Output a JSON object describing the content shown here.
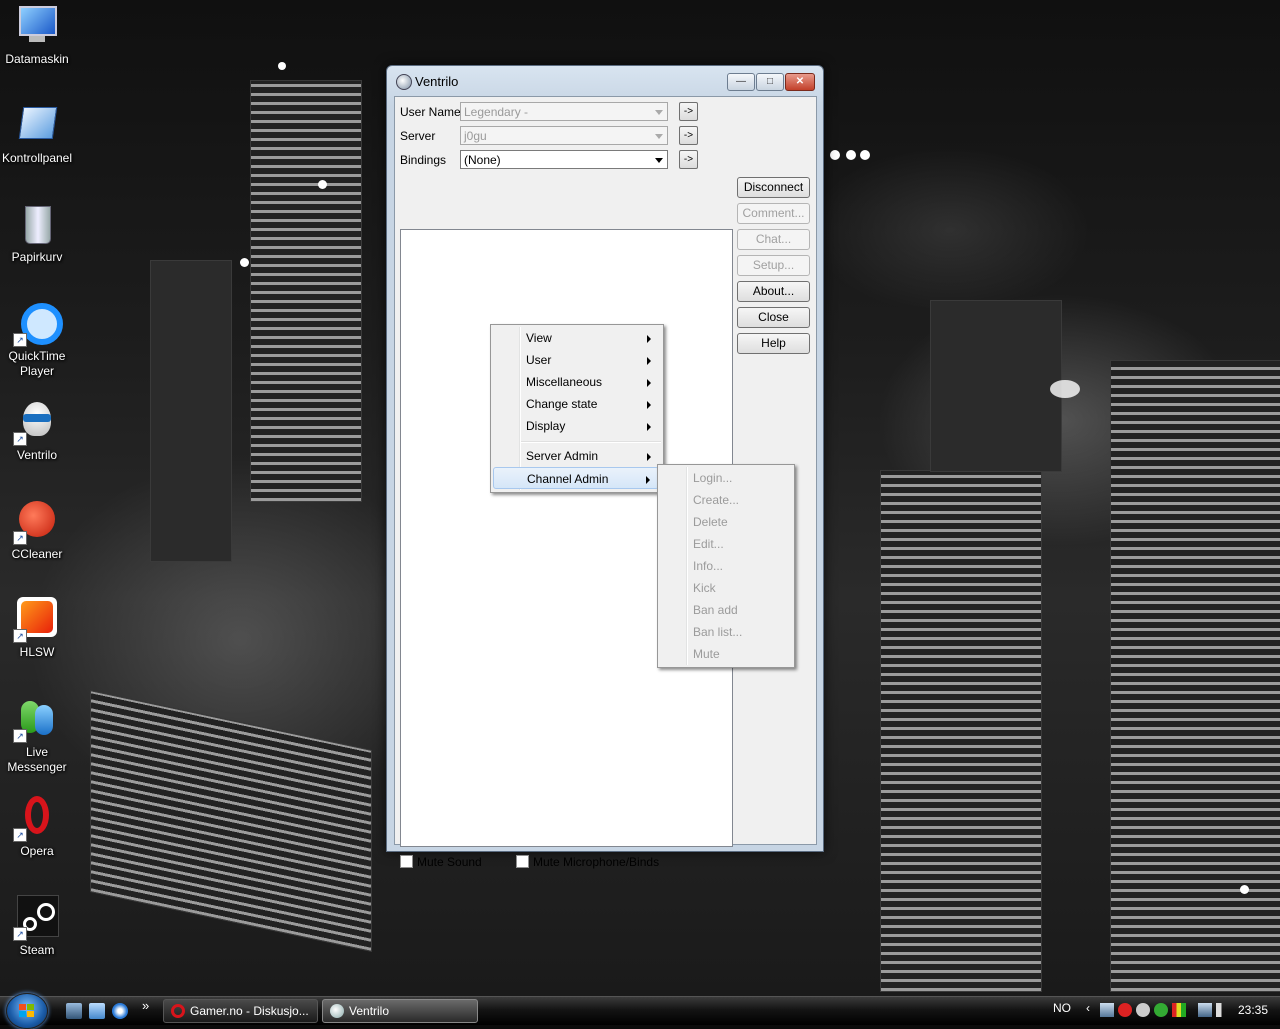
{
  "desktop": {
    "icons": [
      {
        "label": "Datamaskin",
        "icon": "computer-icon"
      },
      {
        "label": "Kontrollpanel",
        "icon": "control-panel-icon"
      },
      {
        "label": "Papirkurv",
        "icon": "recycle-bin-icon"
      },
      {
        "label": "QuickTime Player",
        "icon": "quicktime-icon"
      },
      {
        "label": "Ventrilo",
        "icon": "ventrilo-icon"
      },
      {
        "label": "CCleaner",
        "icon": "ccleaner-icon"
      },
      {
        "label": "HLSW",
        "icon": "hlsw-icon"
      },
      {
        "label": "Live Messenger",
        "icon": "messenger-icon"
      },
      {
        "label": "Opera",
        "icon": "opera-icon"
      },
      {
        "label": "Steam",
        "icon": "steam-icon"
      }
    ]
  },
  "window": {
    "title": "Ventrilo",
    "caption_buttons": {
      "minimize": "—",
      "maximize": "□",
      "close": "✕"
    },
    "fields": {
      "username_label": "User Name",
      "username_value": "Legendary -",
      "server_label": "Server",
      "server_value": "j0gu",
      "bindings_label": "Bindings",
      "bindings_value": "(None)",
      "arrow_button": "->"
    },
    "buttons": {
      "disconnect": "Disconnect",
      "comment": "Comment...",
      "chat": "Chat...",
      "setup": "Setup...",
      "about": "About...",
      "close": "Close",
      "help": "Help"
    },
    "checkboxes": {
      "mute_sound": "Mute Sound",
      "mute_mic": "Mute Microphone/Binds"
    }
  },
  "context_menu": {
    "items": [
      "View",
      "User",
      "Miscellaneous",
      "Change state",
      "Display"
    ],
    "admin_items": [
      "Server Admin",
      "Channel Admin"
    ]
  },
  "submenu": {
    "items": [
      "Login...",
      "Create...",
      "Delete",
      "Edit...",
      "Info...",
      "Kick",
      "Ban add",
      "Ban list...",
      "Mute"
    ]
  },
  "taskbar": {
    "overflow": "»",
    "tasks": [
      {
        "label": "Gamer.no - Diskusjo...",
        "icon": "opera-icon"
      },
      {
        "label": "Ventrilo",
        "icon": "ventrilo-icon"
      }
    ],
    "language": "NO",
    "tray_chevron": "‹",
    "clock": "23:35"
  }
}
